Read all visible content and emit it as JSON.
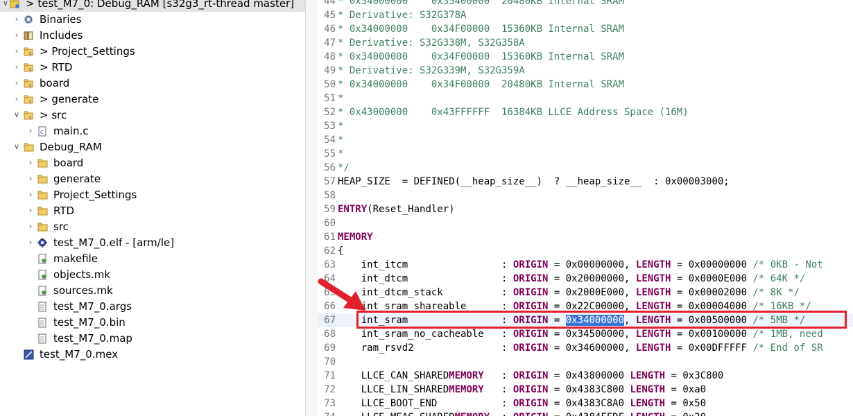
{
  "explorer": {
    "items": [
      {
        "label": "> test_M7_0: Debug_RAM [s32g3_rt-thread master]",
        "chevron": "expanded",
        "icon": "project-icon"
      },
      {
        "label": "Binaries",
        "chevron": "collapsed",
        "icon": "binaries-icon"
      },
      {
        "label": "Includes",
        "chevron": "collapsed",
        "icon": "includes-icon"
      },
      {
        "label": "> Project_Settings",
        "chevron": "collapsed",
        "icon": "source-folder-icon"
      },
      {
        "label": "> RTD",
        "chevron": "collapsed",
        "icon": "source-folder-icon"
      },
      {
        "label": "board",
        "chevron": "collapsed",
        "icon": "source-folder-icon"
      },
      {
        "label": "> generate",
        "chevron": "collapsed",
        "icon": "source-folder-icon"
      },
      {
        "label": "> src",
        "chevron": "expanded",
        "icon": "source-folder-icon"
      },
      {
        "label": "main.c",
        "chevron": "collapsed",
        "icon": "c-file-icon"
      },
      {
        "label": "Debug_RAM",
        "chevron": "expanded",
        "icon": "folder-icon"
      },
      {
        "label": "board",
        "chevron": "collapsed",
        "icon": "folder-icon"
      },
      {
        "label": "generate",
        "chevron": "collapsed",
        "icon": "folder-icon"
      },
      {
        "label": "Project_Settings",
        "chevron": "collapsed",
        "icon": "folder-icon"
      },
      {
        "label": "RTD",
        "chevron": "collapsed",
        "icon": "folder-icon"
      },
      {
        "label": "src",
        "chevron": "collapsed",
        "icon": "folder-icon"
      },
      {
        "label": "test_M7_0.elf - [arm/le]",
        "chevron": "collapsed",
        "icon": "elf-binary-icon"
      },
      {
        "label": "makefile",
        "chevron": "none",
        "icon": "makefile-icon"
      },
      {
        "label": "objects.mk",
        "chevron": "none",
        "icon": "makefile-icon"
      },
      {
        "label": "sources.mk",
        "chevron": "none",
        "icon": "makefile-icon"
      },
      {
        "label": "test_M7_0.args",
        "chevron": "none",
        "icon": "text-file-icon"
      },
      {
        "label": "test_M7_0.bin",
        "chevron": "none",
        "icon": "text-file-icon"
      },
      {
        "label": "test_M7_0.map",
        "chevron": "none",
        "icon": "text-file-icon"
      },
      {
        "label": "test_M7_0.mex",
        "chevron": "none",
        "icon": "mex-file-icon"
      }
    ]
  },
  "editor": {
    "lines": [
      {
        "num": "44",
        "segs": [
          {
            "t": "* 0x34000000    0x35400000  20480KB Internal SRAM",
            "c": "cmt"
          }
        ]
      },
      {
        "num": "45",
        "segs": [
          {
            "t": "* Derivative: S32G378A",
            "c": "cmt"
          }
        ]
      },
      {
        "num": "46",
        "segs": [
          {
            "t": "* 0x34000000    0x34F00000  15360KB Internal SRAM",
            "c": "cmt"
          }
        ]
      },
      {
        "num": "47",
        "segs": [
          {
            "t": "* Derivative: S32G338M, S32G358A",
            "c": "cmt"
          }
        ]
      },
      {
        "num": "48",
        "segs": [
          {
            "t": "* 0x34000000    0x34F00000  15360KB Internal SRAM",
            "c": "cmt"
          }
        ]
      },
      {
        "num": "49",
        "segs": [
          {
            "t": "* Derivative: S32G339M, S32G359A",
            "c": "cmt"
          }
        ]
      },
      {
        "num": "50",
        "segs": [
          {
            "t": "* 0x34000000    0x34F00000  20480KB Internal SRAM",
            "c": "cmt"
          }
        ]
      },
      {
        "num": "51",
        "segs": [
          {
            "t": "*",
            "c": "cmt"
          }
        ]
      },
      {
        "num": "52",
        "segs": [
          {
            "t": "* 0x43000000    0x43FFFFFF  16384KB LLCE Address Space (16M)",
            "c": "cmt"
          }
        ]
      },
      {
        "num": "53",
        "segs": [
          {
            "t": "*",
            "c": "cmt"
          }
        ]
      },
      {
        "num": "54",
        "segs": [
          {
            "t": "*",
            "c": "cmt"
          }
        ]
      },
      {
        "num": "55",
        "segs": [
          {
            "t": "*",
            "c": "cmt"
          }
        ]
      },
      {
        "num": "56",
        "segs": [
          {
            "t": "*/",
            "c": "cmt"
          }
        ]
      },
      {
        "num": "57",
        "segs": [
          {
            "t": "HEAP_SIZE  = DEFINED(__heap_size__)  ? __heap_size__  : 0x00003000;",
            "c": ""
          }
        ]
      },
      {
        "num": "58",
        "segs": [
          {
            "t": "",
            "c": ""
          }
        ]
      },
      {
        "num": "59",
        "segs": [
          {
            "t": "ENTRY",
            "c": "kw"
          },
          {
            "t": "(Reset_Handler)",
            "c": ""
          }
        ]
      },
      {
        "num": "60",
        "segs": [
          {
            "t": "",
            "c": ""
          }
        ]
      },
      {
        "num": "61",
        "segs": [
          {
            "t": "MEMORY",
            "c": "kw"
          }
        ]
      },
      {
        "num": "62",
        "segs": [
          {
            "t": "{",
            "c": ""
          }
        ]
      },
      {
        "num": "63",
        "segs": [
          {
            "t": "    int_itcm                : ",
            "c": ""
          },
          {
            "t": "ORIGIN",
            "c": "kwp"
          },
          {
            "t": " = 0x00000000, ",
            "c": ""
          },
          {
            "t": "LENGTH",
            "c": "kwp"
          },
          {
            "t": " = 0x00000000 ",
            "c": ""
          },
          {
            "t": "/* 0KB - Not",
            "c": "cmt"
          }
        ]
      },
      {
        "num": "64",
        "segs": [
          {
            "t": "    int_dtcm                : ",
            "c": ""
          },
          {
            "t": "ORIGIN",
            "c": "kwp"
          },
          {
            "t": " = 0x20000000, ",
            "c": ""
          },
          {
            "t": "LENGTH",
            "c": "kwp"
          },
          {
            "t": " = 0x0000E000 ",
            "c": ""
          },
          {
            "t": "/* 64K */",
            "c": "cmt"
          }
        ]
      },
      {
        "num": "65",
        "segs": [
          {
            "t": "    int_dtcm_stack          : ",
            "c": ""
          },
          {
            "t": "ORIGIN",
            "c": "kwp"
          },
          {
            "t": " = 0x2000E000, ",
            "c": ""
          },
          {
            "t": "LENGTH",
            "c": "kwp"
          },
          {
            "t": " = 0x00002000 ",
            "c": ""
          },
          {
            "t": "/* 8K */",
            "c": "cmt"
          }
        ]
      },
      {
        "num": "66",
        "segs": [
          {
            "t": "    int_sram_shareable      : ",
            "c": ""
          },
          {
            "t": "ORIGIN",
            "c": "kwp"
          },
          {
            "t": " = 0x22C00000, ",
            "c": ""
          },
          {
            "t": "LENGTH",
            "c": "kwp"
          },
          {
            "t": " = 0x00004000 ",
            "c": ""
          },
          {
            "t": "/* 16KB */",
            "c": "cmt"
          }
        ]
      },
      {
        "num": "67",
        "segs": [
          {
            "t": "    int_sram                : ",
            "c": ""
          },
          {
            "t": "ORIGIN",
            "c": "kwp"
          },
          {
            "t": " = ",
            "c": ""
          },
          {
            "t": "0x34000000",
            "c": "sel"
          },
          {
            "t": ", ",
            "c": ""
          },
          {
            "t": "LENGTH",
            "c": "kwp"
          },
          {
            "t": " = 0x00500000 ",
            "c": ""
          },
          {
            "t": "/* 5MB */",
            "c": "cmt"
          }
        ]
      },
      {
        "num": "68",
        "segs": [
          {
            "t": "    int_sram_no_cacheable   : ",
            "c": ""
          },
          {
            "t": "ORIGIN",
            "c": "kwp"
          },
          {
            "t": " = 0x34500000, ",
            "c": ""
          },
          {
            "t": "LENGTH",
            "c": "kwp"
          },
          {
            "t": " = 0x00100000 ",
            "c": ""
          },
          {
            "t": "/* 1MB, need",
            "c": "cmt"
          }
        ]
      },
      {
        "num": "69",
        "segs": [
          {
            "t": "    ram_rsvd2               : ",
            "c": ""
          },
          {
            "t": "ORIGIN",
            "c": "kwp"
          },
          {
            "t": " = 0x34600000, ",
            "c": ""
          },
          {
            "t": "LENGTH",
            "c": "kwp"
          },
          {
            "t": " = 0x00DFFFFF ",
            "c": ""
          },
          {
            "t": "/* End of SR",
            "c": "cmt"
          }
        ]
      },
      {
        "num": "70",
        "segs": [
          {
            "t": "",
            "c": ""
          }
        ]
      },
      {
        "num": "71",
        "segs": [
          {
            "t": "    LLCE_CAN_SHARED",
            "c": ""
          },
          {
            "t": "MEMORY",
            "c": "kw"
          },
          {
            "t": "   : ",
            "c": ""
          },
          {
            "t": "ORIGIN",
            "c": "kwp"
          },
          {
            "t": " = 0x43800000 ",
            "c": ""
          },
          {
            "t": "LENGTH",
            "c": "kwp"
          },
          {
            "t": " = 0x3C800",
            "c": ""
          }
        ]
      },
      {
        "num": "72",
        "segs": [
          {
            "t": "    LLCE_LIN_SHARED",
            "c": ""
          },
          {
            "t": "MEMORY",
            "c": "kw"
          },
          {
            "t": "   : ",
            "c": ""
          },
          {
            "t": "ORIGIN",
            "c": "kwp"
          },
          {
            "t": " = 0x4383C800 ",
            "c": ""
          },
          {
            "t": "LENGTH",
            "c": "kwp"
          },
          {
            "t": " = 0xa0",
            "c": ""
          }
        ]
      },
      {
        "num": "73",
        "segs": [
          {
            "t": "    LLCE_BOOT_END           : ",
            "c": ""
          },
          {
            "t": "ORIGIN",
            "c": "kwp"
          },
          {
            "t": " = 0x4383C8A0 ",
            "c": ""
          },
          {
            "t": "LENGTH",
            "c": "kwp"
          },
          {
            "t": " = 0x50",
            "c": ""
          }
        ]
      },
      {
        "num": "74",
        "segs": [
          {
            "t": "    LLCE_MEAS_SHARED",
            "c": ""
          },
          {
            "t": "MEMORY",
            "c": "kw"
          },
          {
            "t": "  : ",
            "c": ""
          },
          {
            "t": "ORIGIN",
            "c": "kwp"
          },
          {
            "t": " = 0x4384FFDF ",
            "c": ""
          },
          {
            "t": "LENGTH",
            "c": "kwp"
          },
          {
            "t": " = 0x20",
            "c": ""
          }
        ]
      }
    ]
  },
  "annotation": {
    "box_color": "#e0202c",
    "arrow_color": "#e0202c"
  }
}
